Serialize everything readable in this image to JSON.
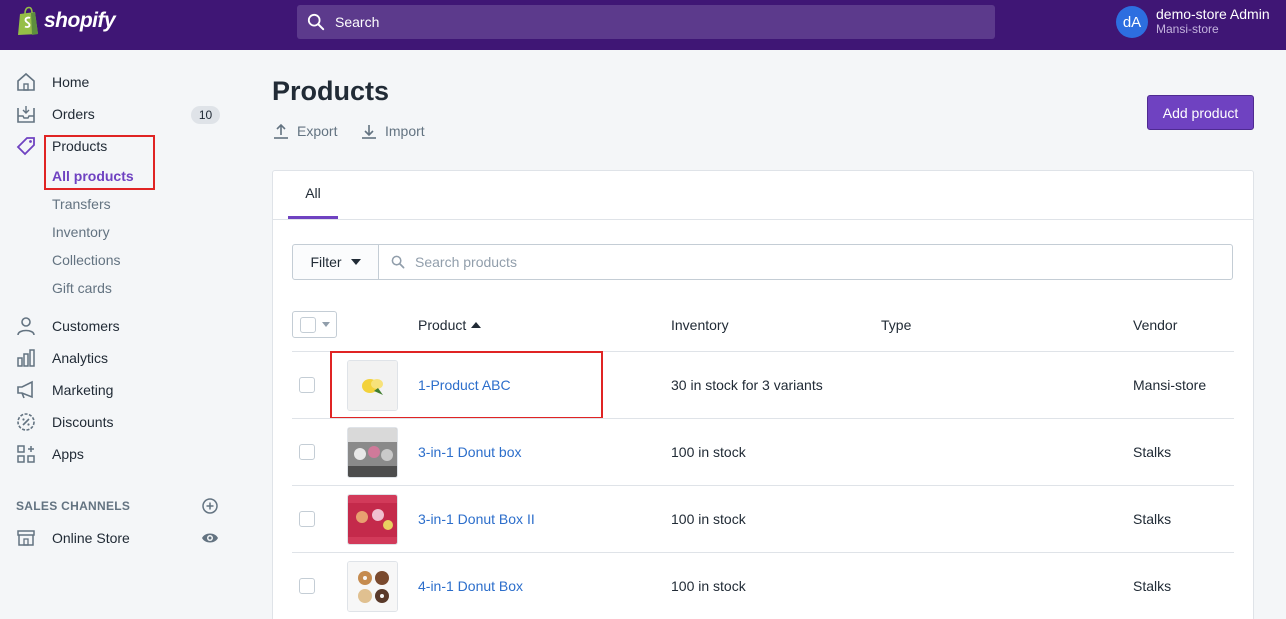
{
  "topbar": {
    "brand": "shopify",
    "search_placeholder": "Search",
    "user_initials": "dA",
    "user_name": "demo-store Admin",
    "store_name": "Mansi-store"
  },
  "sidebar": {
    "home": "Home",
    "orders": "Orders",
    "orders_badge": "10",
    "products": "Products",
    "products_sub": [
      "All products",
      "Transfers",
      "Inventory",
      "Collections",
      "Gift cards"
    ],
    "customers": "Customers",
    "analytics": "Analytics",
    "marketing": "Marketing",
    "discounts": "Discounts",
    "apps": "Apps",
    "sales_channels_label": "SALES CHANNELS",
    "online_store": "Online Store"
  },
  "page": {
    "title": "Products",
    "export_label": "Export",
    "import_label": "Import",
    "add_product_label": "Add product"
  },
  "tabs": [
    "All"
  ],
  "filter": {
    "filter_label": "Filter",
    "search_placeholder": "Search products"
  },
  "table": {
    "headers": {
      "product": "Product",
      "inventory": "Inventory",
      "type": "Type",
      "vendor": "Vendor"
    },
    "rows": [
      {
        "product": "1-Product ABC",
        "inventory": "30 in stock for 3 variants",
        "type": "",
        "vendor": "Mansi-store"
      },
      {
        "product": "3-in-1 Donut box",
        "inventory": "100 in stock",
        "type": "",
        "vendor": "Stalks"
      },
      {
        "product": "3-in-1 Donut Box II",
        "inventory": "100 in stock",
        "type": "",
        "vendor": "Stalks"
      },
      {
        "product": "4-in-1 Donut Box",
        "inventory": "100 in stock",
        "type": "",
        "vendor": "Stalks"
      }
    ]
  },
  "colors": {
    "topbar": "#3f1675",
    "accent": "#6f42c1",
    "link": "#2c6ecb",
    "highlight": "#e02424"
  }
}
